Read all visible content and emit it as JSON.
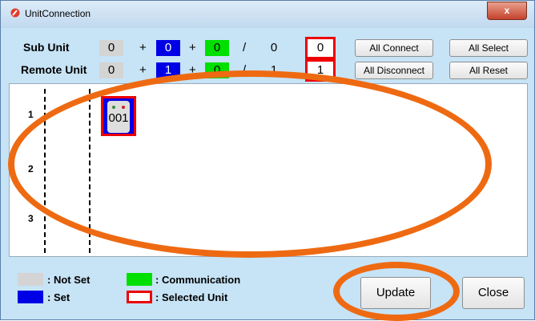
{
  "window": {
    "title": "UnitConnection",
    "close_glyph": "x"
  },
  "sub_unit": {
    "label": "Sub Unit",
    "not_set": "0",
    "set": "0",
    "communication": "0",
    "slash": "/",
    "total": "0",
    "selected": "0"
  },
  "remote_unit": {
    "label": "Remote Unit",
    "not_set": "0",
    "set": "1",
    "communication": "0",
    "slash": "/",
    "total": "1",
    "selected": "1"
  },
  "plus": "+",
  "buttons": {
    "all_connect": "All Connect",
    "all_select": "All Select",
    "all_disconnect": "All Disconnect",
    "all_reset": "All Reset",
    "update": "Update",
    "close": "Close"
  },
  "rows": [
    "1",
    "2",
    "3"
  ],
  "unit": {
    "id": "001"
  },
  "legend": {
    "not_set": ": Not Set",
    "set": ": Set",
    "communication": ": Communication",
    "selected": ": Selected Unit"
  },
  "colors": {
    "not_set": "#d4d4d4",
    "set": "#0000e6",
    "communication": "#00e000",
    "selected": "#e00000",
    "annotation": "#ee6a12"
  }
}
